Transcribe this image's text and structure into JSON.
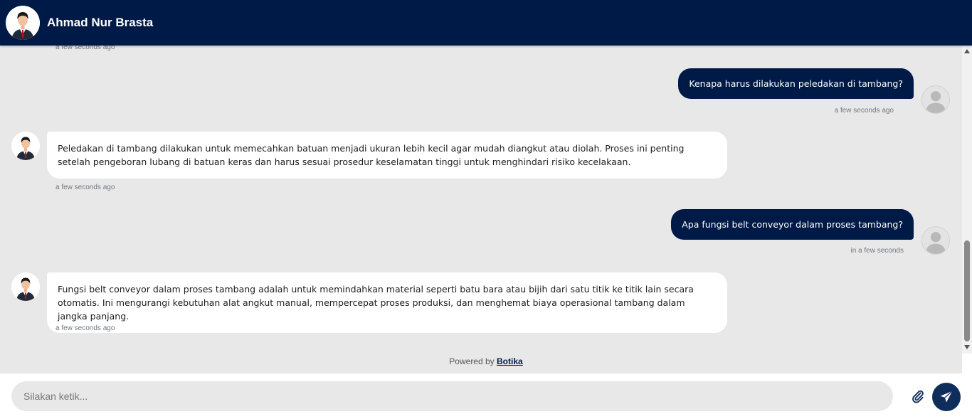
{
  "header": {
    "title": "Ahmad Nur Brasta"
  },
  "messages": [
    {
      "sender": "bot",
      "text": "",
      "timestamp": "a few seconds ago"
    },
    {
      "sender": "user",
      "text": "Kenapa harus dilakukan peledakan di tambang?",
      "timestamp": "a few seconds ago"
    },
    {
      "sender": "bot",
      "text": "Peledakan di tambang dilakukan untuk memecahkan batuan menjadi ukuran lebih kecil agar mudah diangkut atau diolah. Proses ini penting setelah pengeboran lubang di batuan keras dan harus sesuai prosedur keselamatan tinggi untuk menghindari risiko kecelakaan.",
      "timestamp": "a few seconds ago"
    },
    {
      "sender": "user",
      "text": "Apa fungsi belt conveyor dalam proses tambang?",
      "timestamp": "in a few seconds"
    },
    {
      "sender": "bot",
      "text": "Fungsi belt conveyor dalam proses tambang adalah untuk memindahkan material seperti batu bara atau bijih dari satu titik ke titik lain secara otomatis. Ini mengurangi kebutuhan alat angkut manual, mempercepat proses produksi, dan menghemat biaya operasional tambang dalam jangka panjang.",
      "timestamp": "a few seconds ago"
    }
  ],
  "footer": {
    "powered_prefix": "Powered by",
    "powered_brand": "Botika"
  },
  "composer": {
    "placeholder": "Silakan ketik...",
    "value": ""
  },
  "icons": {
    "attach": "paperclip-icon",
    "send": "paper-plane-icon",
    "bot_avatar": "businessman-avatar",
    "user_avatar": "default-user-avatar"
  },
  "colors": {
    "header_bg": "#001a47",
    "user_bubble": "#001a47",
    "chat_bg": "#e8e8e8",
    "bot_bubble": "#ffffff",
    "send_button": "#0f2d5a"
  }
}
